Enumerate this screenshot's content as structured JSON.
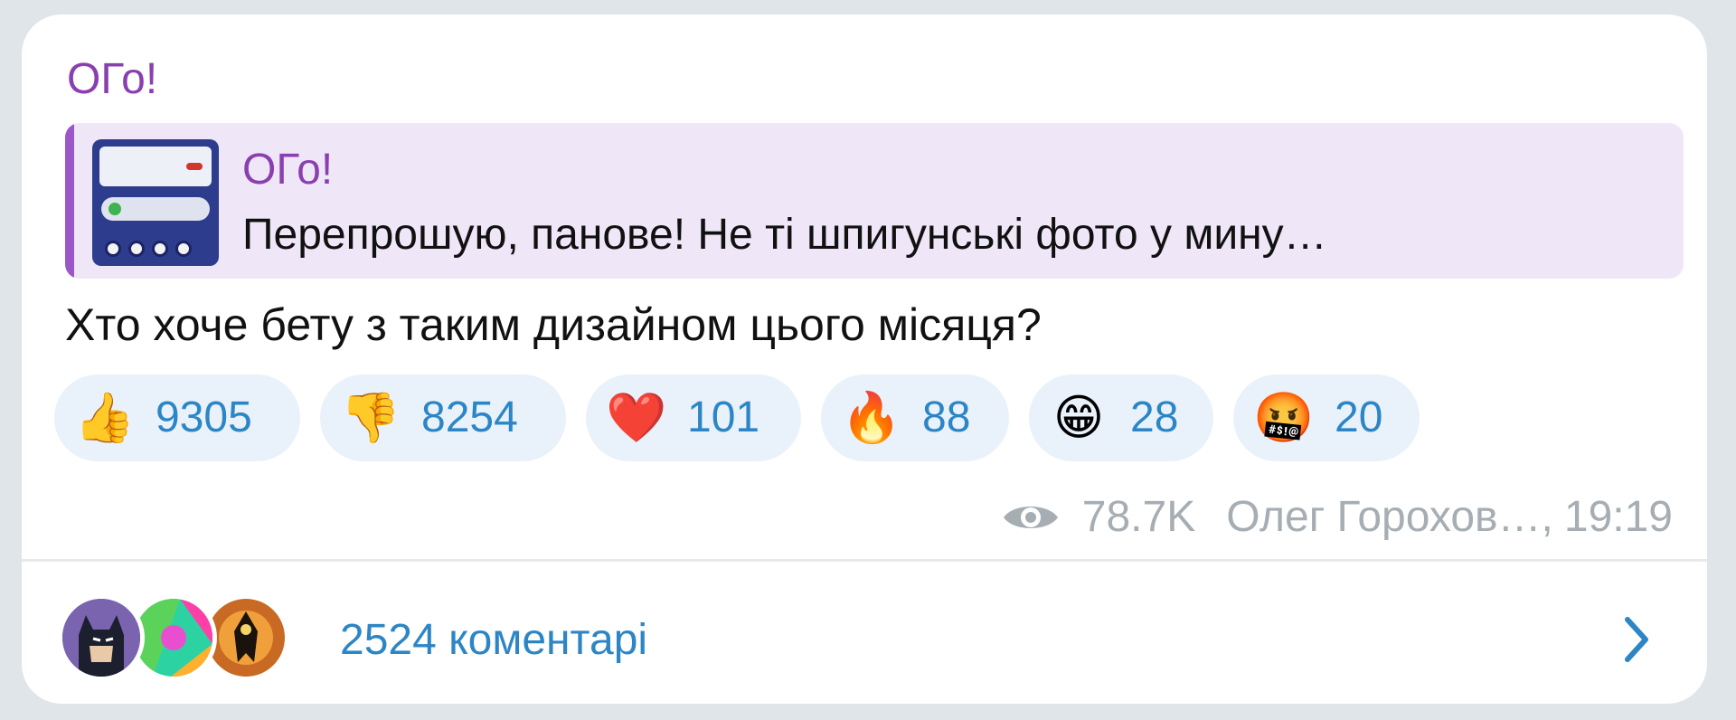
{
  "post": {
    "sender_name": "ОГо!",
    "reply": {
      "name": "ОГо!",
      "text": "Перепрошую, панове! Не ті шпигунські фото у мину…"
    },
    "text": "Хто хоче бету з таким дизайном цього місяця?",
    "reactions": [
      {
        "emoji": "👍",
        "count": "9305",
        "icon": "thumbs-up-icon"
      },
      {
        "emoji": "👎",
        "count": "8254",
        "icon": "thumbs-down-icon"
      },
      {
        "emoji": "❤️",
        "count": "101",
        "icon": "heart-icon"
      },
      {
        "emoji": "🔥",
        "count": "88",
        "icon": "fire-icon"
      },
      {
        "emoji": "😁",
        "count": "28",
        "icon": "grin-icon"
      },
      {
        "emoji": "🤬",
        "count": "20",
        "icon": "cursing-face-icon"
      }
    ],
    "views": "78.7K",
    "author": "Олег Горохов…,",
    "time": "19:19",
    "comments_label": "2524 коментарі"
  },
  "colors": {
    "accent_purple": "#8a3fb0",
    "link_blue": "#2c86c6",
    "reaction_bg": "#e9f2fa",
    "meta_gray": "#a6aeb4"
  }
}
